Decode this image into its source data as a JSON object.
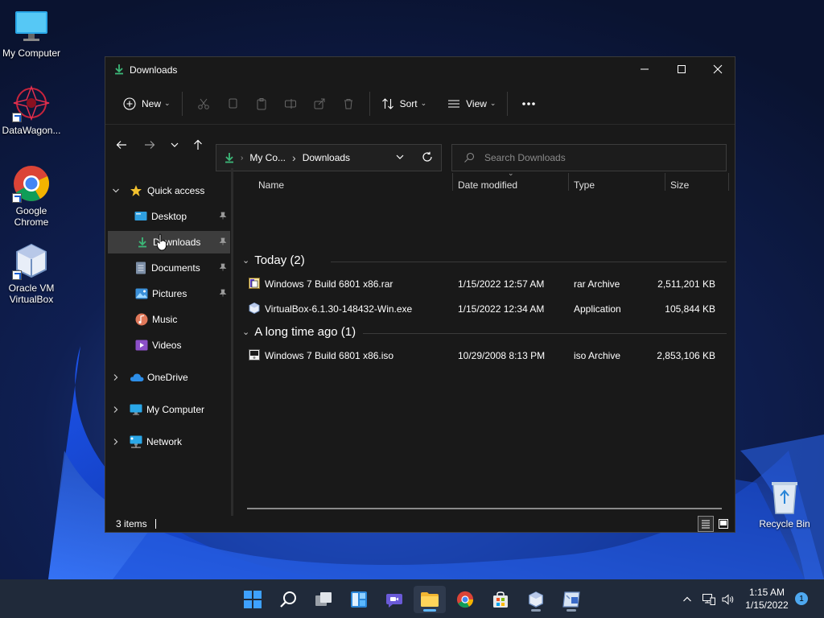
{
  "desktop": {
    "icons": [
      {
        "label": "My Computer"
      },
      {
        "label": "DataWagon..."
      },
      {
        "label": "Google Chrome"
      },
      {
        "label": "Oracle VM VirtualBox"
      },
      {
        "label": "Recycle Bin"
      }
    ]
  },
  "window": {
    "title": "Downloads",
    "controls": {
      "minimize": "minimize-icon",
      "maximize": "maximize-icon",
      "close": "close-icon"
    }
  },
  "commandbar": {
    "new_label": "New",
    "sort_label": "Sort",
    "view_label": "View"
  },
  "address": {
    "crumbs": [
      "My Co...",
      "Downloads"
    ],
    "search_placeholder": "Search Downloads"
  },
  "navpane": {
    "quick_access": "Quick access",
    "items": [
      {
        "label": "Desktop",
        "pinned": true
      },
      {
        "label": "Downloads",
        "pinned": true,
        "selected": true
      },
      {
        "label": "Documents",
        "pinned": true
      },
      {
        "label": "Pictures",
        "pinned": true
      },
      {
        "label": "Music",
        "pinned": false
      },
      {
        "label": "Videos",
        "pinned": false
      }
    ],
    "roots": [
      "OneDrive",
      "My Computer",
      "Network"
    ]
  },
  "content": {
    "columns": [
      "Name",
      "Date modified",
      "Type",
      "Size"
    ],
    "groups": [
      {
        "title": "Today (2)",
        "files": [
          {
            "name": "Windows 7 Build 6801 x86.rar",
            "date": "1/15/2022 12:57 AM",
            "type": "rar Archive",
            "size": "2,511,201 KB"
          },
          {
            "name": "VirtualBox-6.1.30-148432-Win.exe",
            "date": "1/15/2022 12:34 AM",
            "type": "Application",
            "size": "105,844 KB"
          }
        ]
      },
      {
        "title": "A long time ago (1)",
        "files": [
          {
            "name": "Windows 7 Build 6801 x86.iso",
            "date": "10/29/2008 8:13 PM",
            "type": "iso Archive",
            "size": "2,853,106 KB"
          }
        ]
      }
    ]
  },
  "status": {
    "items": "3 items"
  },
  "taskbar": {
    "time": "1:15 AM",
    "date": "1/15/2022",
    "notification_count": "1"
  },
  "colors": {
    "accent": "#0078d4",
    "folder_green": "#3cb878",
    "window_bg": "#191919"
  }
}
